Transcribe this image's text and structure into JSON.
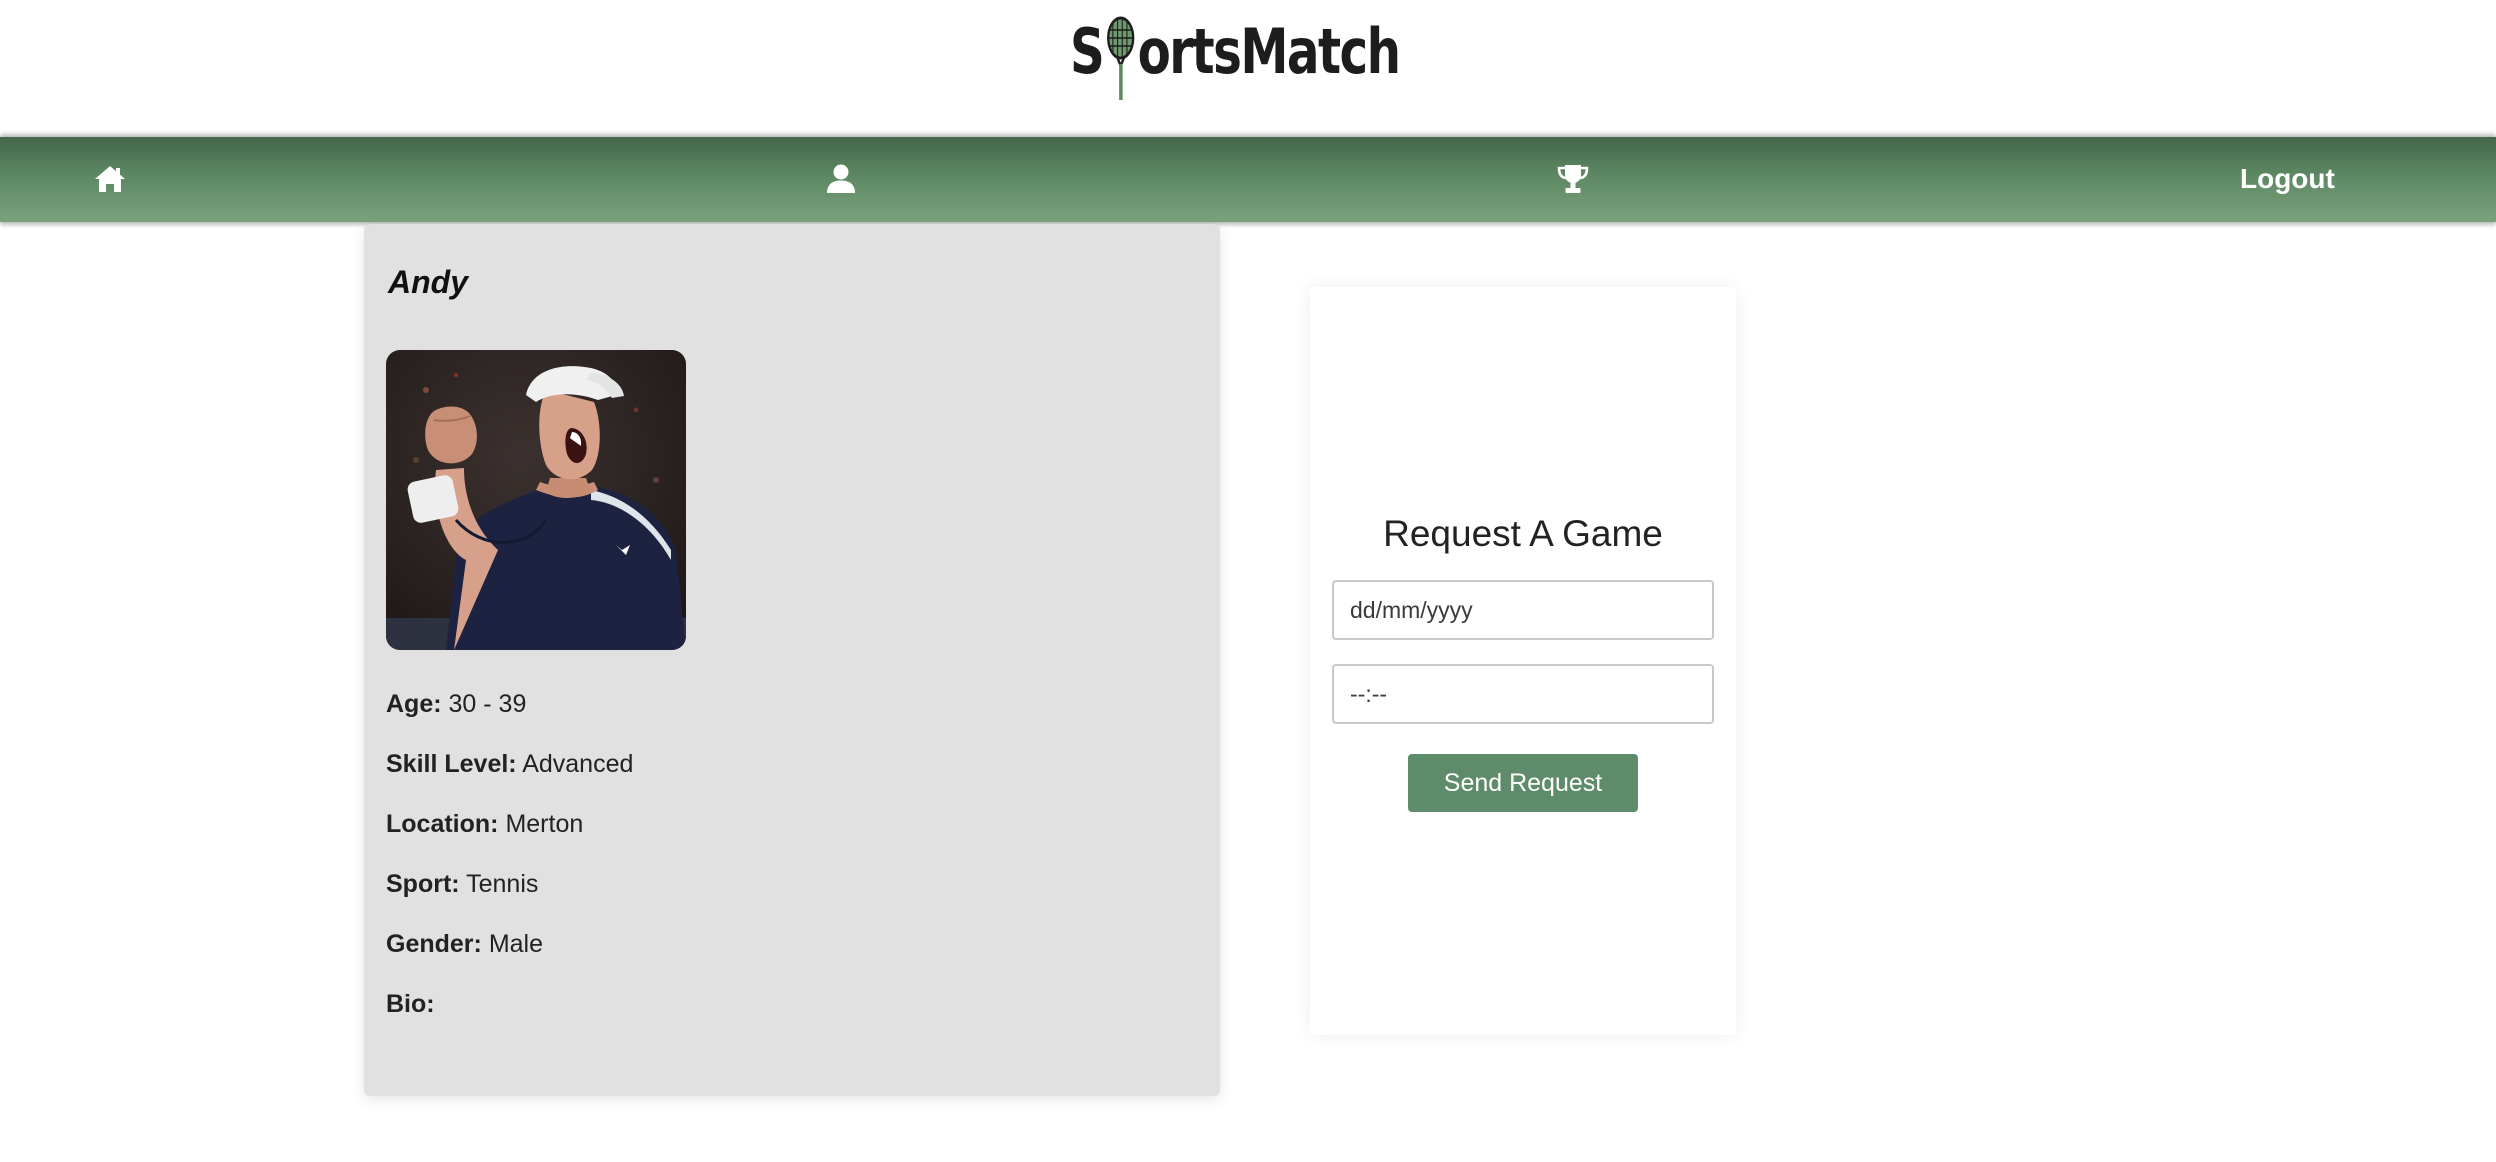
{
  "header": {
    "logo_part1": "S",
    "logo_part2": "ortsMatch",
    "logo_icon": "tennis-racket-icon"
  },
  "navbar": {
    "home_icon": "home-icon",
    "profile_icon": "user-icon",
    "leaderboard_icon": "trophy-icon",
    "logout_label": "Logout",
    "colors": {
      "top": "#44664a",
      "bottom": "#7aa27c"
    }
  },
  "profile": {
    "name": "Andy",
    "photo": "player-photo",
    "details": [
      {
        "label": "Age:",
        "value": "30 - 39"
      },
      {
        "label": "Skill Level:",
        "value": "Advanced"
      },
      {
        "label": "Location:",
        "value": "Merton"
      },
      {
        "label": "Sport:",
        "value": "Tennis"
      },
      {
        "label": "Gender:",
        "value": "Male"
      },
      {
        "label": "Bio:",
        "value": ""
      }
    ],
    "background_color": "#e1e1e1"
  },
  "request": {
    "title": "Request A Game",
    "date_placeholder": "dd/mm/yyyy",
    "time_placeholder": "--:--",
    "send_label": "Send Request",
    "button_color": "#5e8b6a"
  }
}
